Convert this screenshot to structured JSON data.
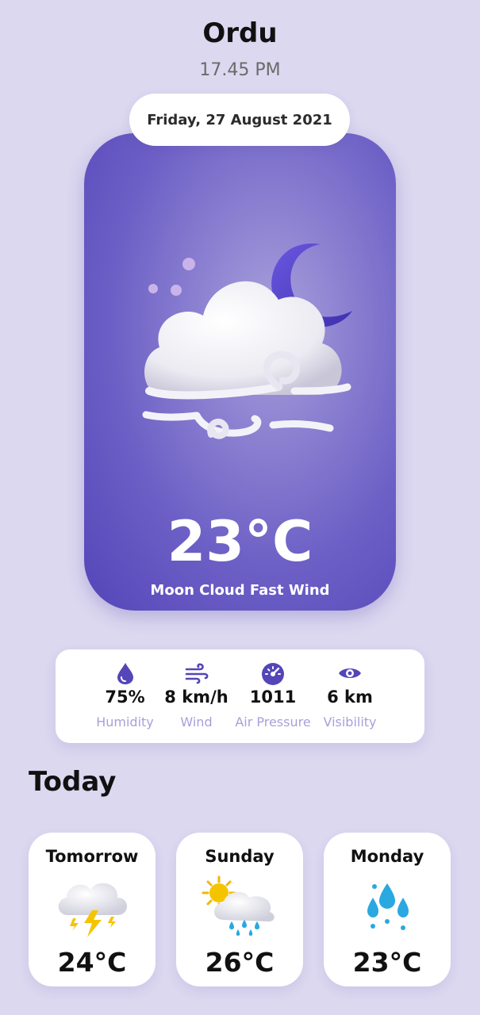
{
  "location": {
    "city": "Ordu",
    "time": "17.45 PM",
    "date": "Friday, 27 August 2021"
  },
  "current": {
    "temperature": "23°C",
    "condition": "Moon Cloud Fast Wind",
    "icon": "moon-cloud-fast-wind-icon"
  },
  "stats": [
    {
      "icon": "humidity-drop-icon",
      "value": "75%",
      "label": "Humidity"
    },
    {
      "icon": "wind-icon",
      "value": "8 km/h",
      "label": "Wind"
    },
    {
      "icon": "air-pressure-gauge-icon",
      "value": "1011",
      "label": "Air Pressure"
    },
    {
      "icon": "visibility-eye-icon",
      "value": "6 km",
      "label": "Visibility"
    }
  ],
  "section_title": "Today",
  "forecast": [
    {
      "day": "Tomorrow",
      "icon": "thunderstorm-cloud-icon",
      "temperature": "24°C"
    },
    {
      "day": "Sunday",
      "icon": "sun-cloud-rain-icon",
      "temperature": "26°C"
    },
    {
      "day": "Monday",
      "icon": "rain-drops-icon",
      "temperature": "23°C"
    }
  ],
  "colors": {
    "background": "#dcd8f0",
    "accent": "#5445b8",
    "label": "#a99fd9"
  }
}
